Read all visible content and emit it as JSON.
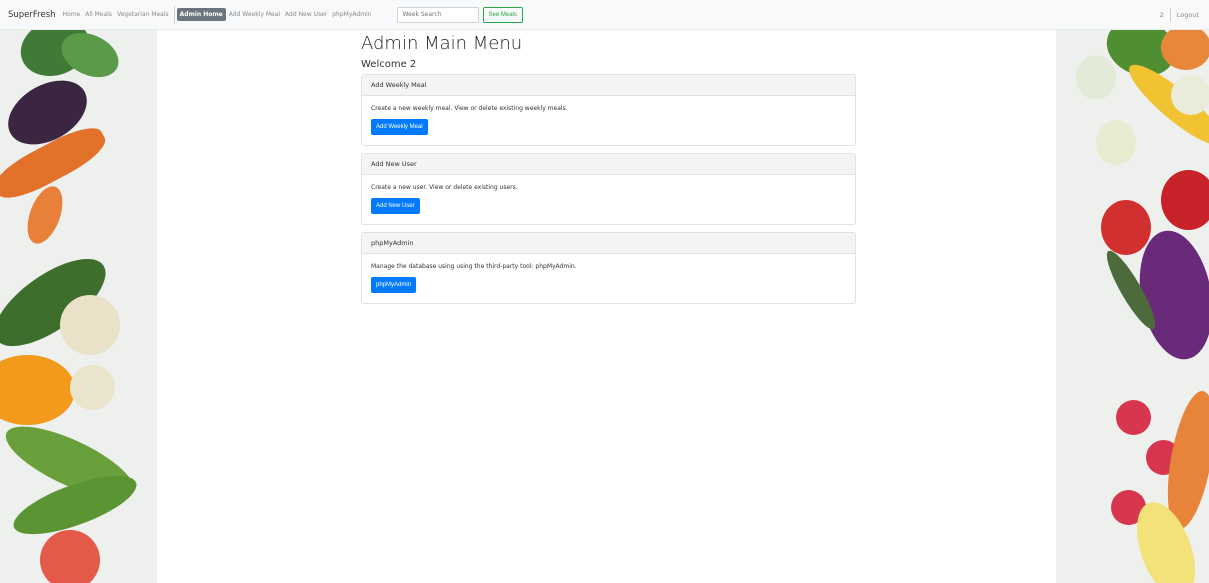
{
  "navbar": {
    "brand": "SuperFresh",
    "links": [
      "Home",
      "All Meals",
      "Vegetarian Meals"
    ],
    "active_link": "Admin Home",
    "admin_links": [
      "Add Weekly Meal",
      "Add New User",
      "phpMyAdmin"
    ],
    "search_placeholder": "Week Search",
    "search_button": "See Meals",
    "user": "2",
    "logout": "Logout"
  },
  "main": {
    "title": "Admin Main Menu",
    "welcome": "Welcome 2",
    "cards": [
      {
        "header": "Add Weekly Meal",
        "text": "Create a new weekly meal. View or delete existing weekly meals.",
        "button": "Add Weekly Meal"
      },
      {
        "header": "Add New User",
        "text": "Create a new user. View or delete existing users.",
        "button": "Add New User"
      },
      {
        "header": "phpMyAdmin",
        "text": "Manage the database using using the third-party tool: phpMyAdmin.",
        "button": "phpMyAdmin"
      }
    ]
  },
  "colors": {
    "primary": "#007bff",
    "success": "#28a745",
    "active_nav": "#6c757d"
  }
}
